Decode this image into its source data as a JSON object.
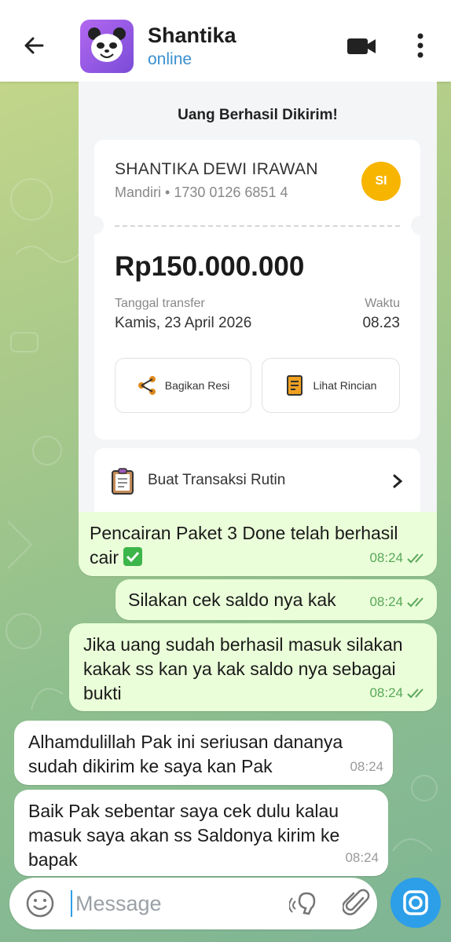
{
  "header": {
    "name": "Shantika",
    "status": "online"
  },
  "receipt": {
    "title": "Uang Berhasil Dikirim!",
    "recipient_name": "SHANTIKA DEWI IRAWAN",
    "bank_account": "Mandiri • 1730 0126 6851 4",
    "initials": "SI",
    "amount": "Rp150.000.000",
    "date_label": "Tanggal transfer",
    "date_value": "Kamis, 23 April 2026",
    "time_label": "Waktu",
    "time_value": "08.23",
    "share_label": "Bagikan Resi",
    "details_label": "Lihat Rincian",
    "routine_label": "Buat Transaksi Rutin"
  },
  "messages": [
    {
      "text": "Pencairan Paket 3 Done telah berhasil cair",
      "time": "08:24",
      "direction": "out"
    },
    {
      "text": "Silakan cek saldo nya kak",
      "time": "08:24",
      "direction": "out"
    },
    {
      "text": "Jika uang sudah berhasil masuk silakan kakak ss kan ya kak saldo nya sebagai bukti",
      "time": "08:24",
      "direction": "out"
    },
    {
      "text": "Alhamdulillah Pak ini seriusan dananya sudah dikirim ke saya kan Pak",
      "time": "08:24",
      "direction": "in"
    },
    {
      "text": "Baik Pak sebentar saya cek dulu kalau masuk saya akan ss Saldonya kirim ke bapak",
      "time": "08:24",
      "direction": "in"
    }
  ],
  "input": {
    "placeholder": "Message"
  },
  "colors": {
    "outgoing_bubble": "#eaffd9",
    "incoming_bubble": "#ffffff",
    "accent": "#2d9ee8",
    "online": "#3a8fd0"
  },
  "icons": [
    "back-arrow-icon",
    "video-call-icon",
    "more-vert-icon",
    "share-icon",
    "receipt-icon",
    "clipboard-icon",
    "chevron-right-icon",
    "emoji-icon",
    "voice-icon",
    "attach-icon",
    "camera-icon"
  ]
}
